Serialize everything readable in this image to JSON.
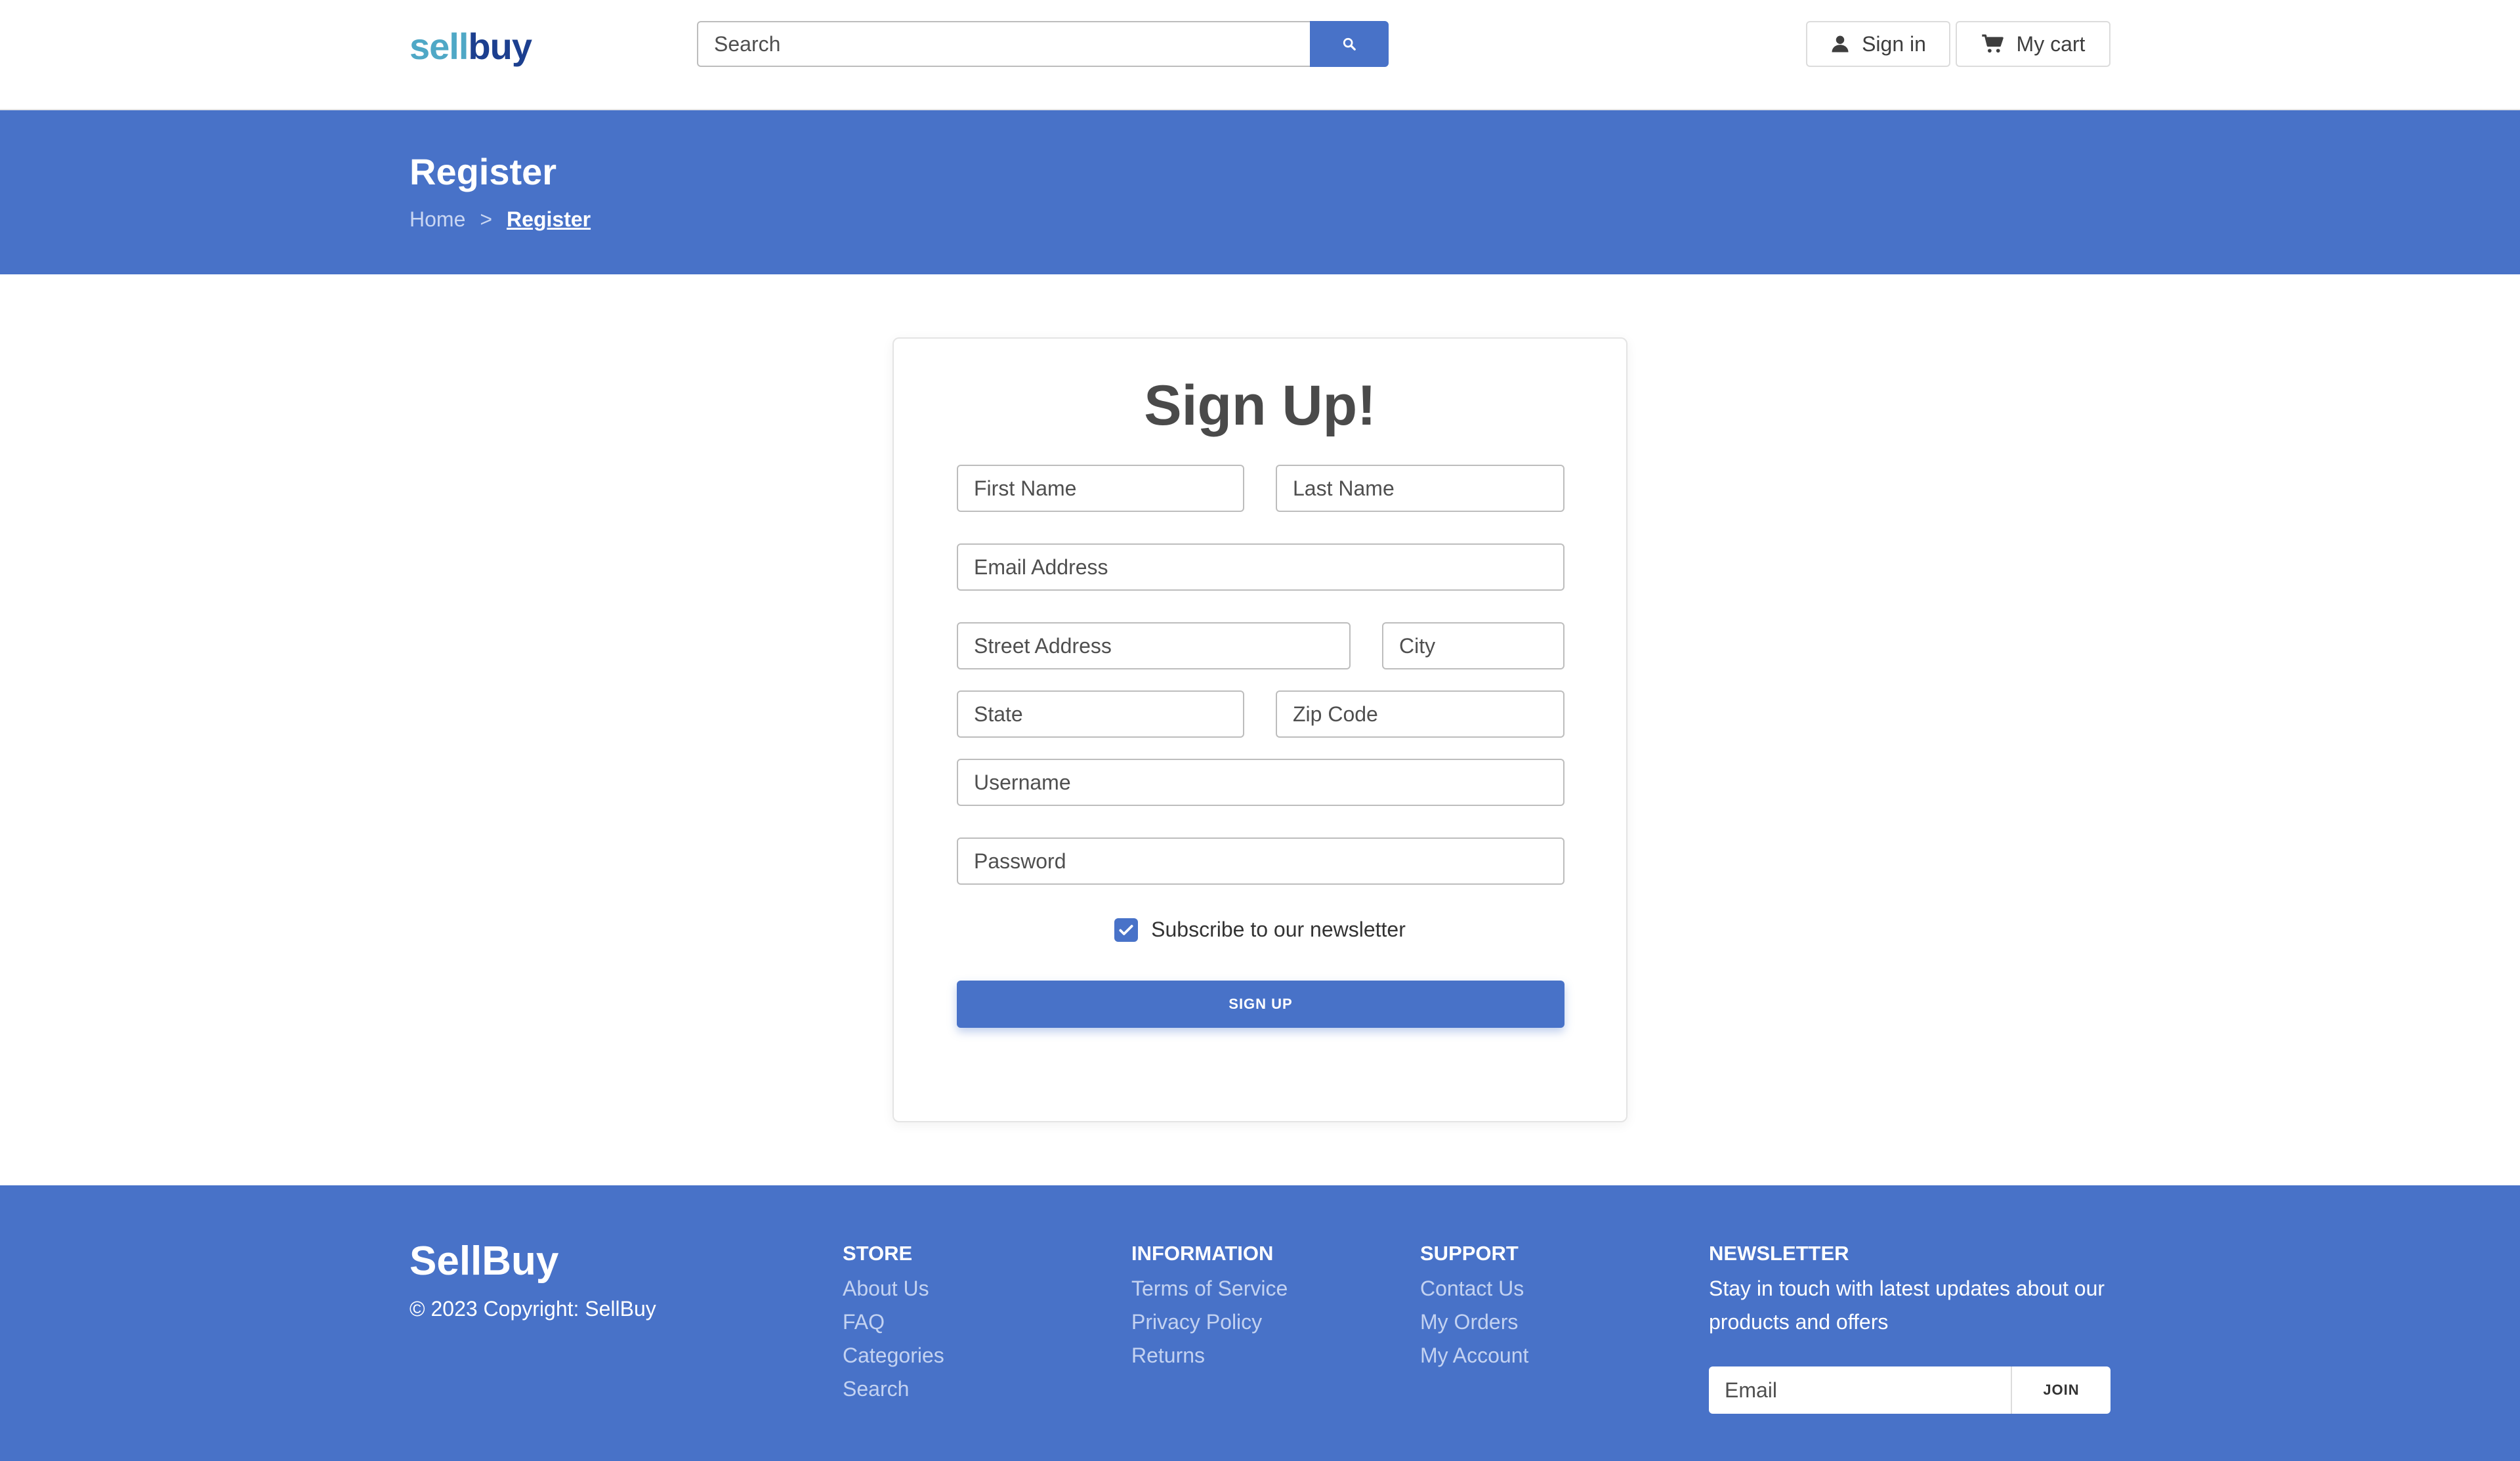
{
  "header": {
    "logo_part1": "sell",
    "logo_part2": "buy",
    "search_placeholder": "Search",
    "signin_label": "Sign in",
    "cart_label": "My cart"
  },
  "banner": {
    "title": "Register",
    "breadcrumb": {
      "home": "Home",
      "separator": ">",
      "current": "Register"
    }
  },
  "form": {
    "title": "Sign Up!",
    "first_name": "First Name",
    "last_name": "Last Name",
    "email": "Email Address",
    "street": "Street Address",
    "city": "City",
    "state": "State",
    "zip": "Zip Code",
    "username": "Username",
    "password": "Password",
    "newsletter_label": "Subscribe to our newsletter",
    "newsletter_checked": true,
    "submit_label": "SIGN UP"
  },
  "footer": {
    "brand": "SellBuy",
    "copyright": "© 2023 Copyright: SellBuy",
    "store": {
      "heading": "STORE",
      "links": [
        "About Us",
        "FAQ",
        "Categories",
        "Search"
      ]
    },
    "information": {
      "heading": "INFORMATION",
      "links": [
        "Terms of Service",
        "Privacy Policy",
        "Returns"
      ]
    },
    "support": {
      "heading": "SUPPORT",
      "links": [
        "Contact Us",
        "My Orders",
        "My Account"
      ]
    },
    "newsletter": {
      "heading": "NEWSLETTER",
      "text": "Stay in touch with latest updates about our products and offers",
      "email_placeholder": "Email",
      "join_label": "JOIN"
    }
  },
  "colors": {
    "accent": "#4872c8",
    "logo_light": "#4fa8c6",
    "logo_dark": "#1c3f8f"
  }
}
